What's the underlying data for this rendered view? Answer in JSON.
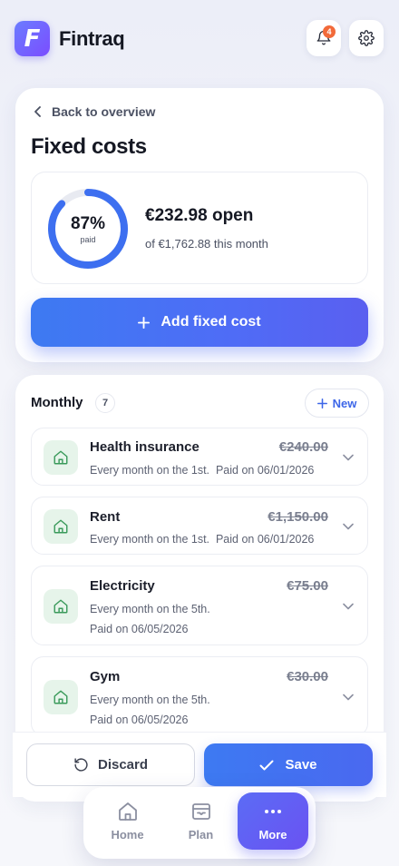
{
  "app": {
    "brand": "Fintraq",
    "logo_letter": "F",
    "notification_count": "4",
    "accent": "#4a6cf4"
  },
  "page": {
    "back_label": "Back to overview",
    "title": "Fixed costs",
    "summary": {
      "percent_label": "87%",
      "percent_value": 0.87,
      "paid_label": "paid",
      "open_label": "€232.98 open",
      "of_label": "of €1,762.88 this month"
    },
    "add_button": "Add fixed cost"
  },
  "monthly": {
    "title": "Monthly",
    "count": "7",
    "new_button": "New",
    "items": [
      {
        "name": "Health insurance",
        "amount": "€240.00",
        "sub1": "Every month on the 1st.  Paid on 06/01/2026",
        "sub2": ""
      },
      {
        "name": "Rent",
        "amount": "€1,150.00",
        "sub1": "Every month on the 1st.  Paid on 06/01/2026",
        "sub2": ""
      },
      {
        "name": "Electricity",
        "amount": "€75.00",
        "sub1": "Every month on the 5th.",
        "sub2": "Paid on 06/05/2026"
      },
      {
        "name": "Gym",
        "amount": "€30.00",
        "sub1": "Every month on the 5th.",
        "sub2": "Paid on 06/05/2026"
      }
    ]
  },
  "footer": {
    "discard": "Discard",
    "save": "Save"
  },
  "nav": {
    "home": "Home",
    "plan": "Plan",
    "more": "More"
  }
}
